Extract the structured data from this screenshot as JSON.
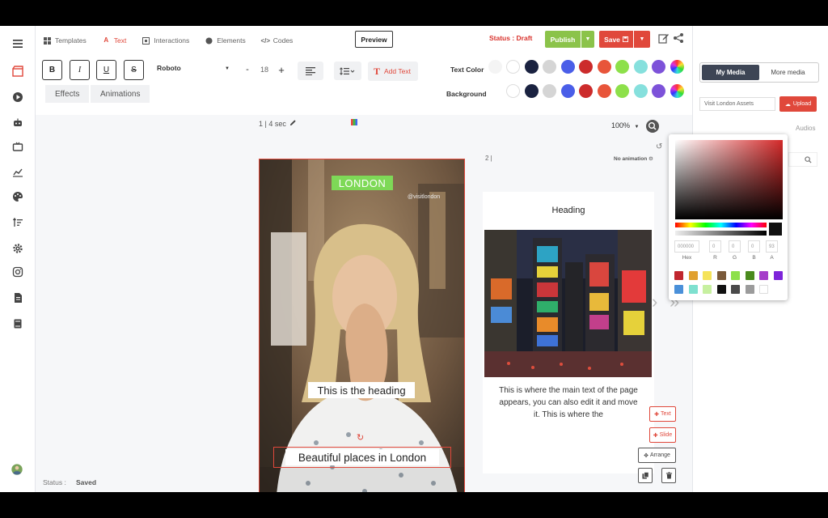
{
  "tabs": [
    {
      "label": "Templates",
      "icon": "grid-icon",
      "active": false
    },
    {
      "label": "Text",
      "icon": "text-icon",
      "active": true
    },
    {
      "label": "Interactions",
      "icon": "interaction-icon",
      "active": false
    },
    {
      "label": "Elements",
      "icon": "elements-icon",
      "active": false
    },
    {
      "label": "Codes",
      "icon": "code-icon",
      "active": false
    }
  ],
  "header": {
    "preview_label": "Preview",
    "status_text": "Status : Draft",
    "publish_label": "Publish",
    "save_label": "Save"
  },
  "toolbar": {
    "bold": "B",
    "italic": "I",
    "underline": "U",
    "strike": "S",
    "font": "Roboto",
    "size_minus": "-",
    "font_size": "18",
    "size_plus": "+",
    "add_text": "Add Text",
    "text_color_label": "Text Color",
    "background_label": "Background",
    "effects_tab": "Effects",
    "animations_tab": "Animations",
    "palette": [
      "#ffffff",
      "#1a2240",
      "#d5d5d5",
      "#4a5ee8",
      "#cc2b2b",
      "#e8553a",
      "#8de04a",
      "#86e0dd",
      "#7d52d9"
    ]
  },
  "canvas": {
    "slide1_meta": "1 |  4 sec",
    "zoom": "100%",
    "slide1": {
      "badge": "LONDON",
      "handle": "@visitlondon",
      "heading": "This is the heading",
      "caption": "Beautiful places in London"
    },
    "slide2_meta": "2 |",
    "no_animation": "No animation",
    "slide2": {
      "heading": "Heading",
      "body": "This is where the main text of the page appears, you can also edit it and move it. This is where the"
    },
    "btn_text": "Text",
    "btn_slide": "Slide",
    "btn_arrange": "Arrange"
  },
  "status_bar": {
    "label": "Status :",
    "value": "Saved"
  },
  "right_panel": {
    "my_media": "My Media",
    "more_media": "More media",
    "asset_select": "Visit London Assets",
    "upload": "Upload",
    "audios": "Audios"
  },
  "picker": {
    "hex_value": "000000",
    "r": "0",
    "g": "0",
    "b": "0",
    "a": "93",
    "labels": [
      "Hex",
      "R",
      "G",
      "B",
      "A"
    ],
    "swatches_row1": [
      "#c0262e",
      "#e0a030",
      "#f5e35a",
      "#7a5a3a",
      "#8de04a",
      "#4a8a1e",
      "#a53ec9",
      "#7d24d9"
    ],
    "swatches_row2": [
      "#4a90d9",
      "#7ee0cf",
      "#c7f0a0",
      "#111111",
      "#4a4a4a",
      "#9b9b9b",
      "#ffffff"
    ]
  }
}
